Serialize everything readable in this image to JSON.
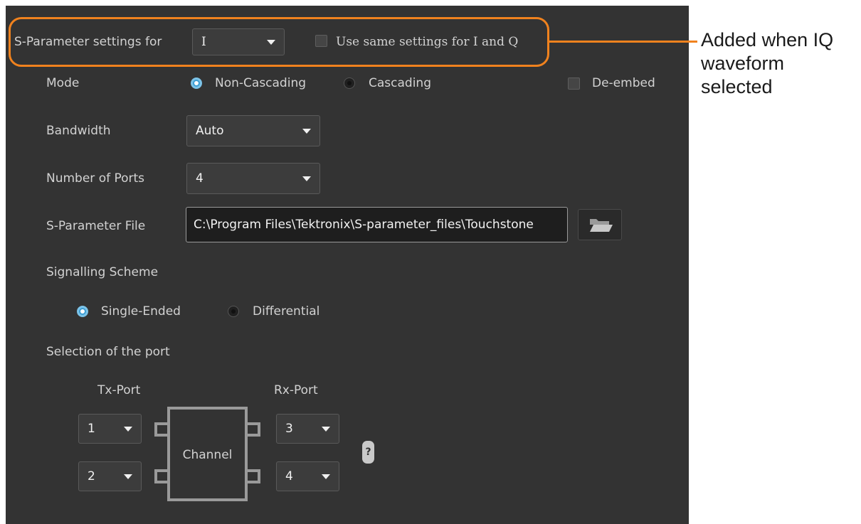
{
  "header": {
    "sparam_label": "S-Parameter settings for",
    "channel_value": "I",
    "same_settings_label": "Use same settings for I and Q"
  },
  "annotation": {
    "line1": "Added when IQ",
    "line2": "waveform selected",
    "color": "#f0821e"
  },
  "mode": {
    "label": "Mode",
    "options": [
      "Non-Cascading",
      "Cascading"
    ],
    "selected": "Non-Cascading",
    "deembed_label": "De-embed"
  },
  "bandwidth": {
    "label": "Bandwidth",
    "value": "Auto"
  },
  "ports": {
    "label": "Number of Ports",
    "value": "4"
  },
  "sparam_file": {
    "label": "S-Parameter File",
    "value": "C:\\Program Files\\Tektronix\\S-parameter_files\\Touchstone",
    "browse_icon": "folder-open-icon"
  },
  "signalling": {
    "label": "Signalling Scheme",
    "options": [
      "Single-Ended",
      "Differential"
    ],
    "selected": "Single-Ended"
  },
  "port_selection": {
    "label": "Selection of the port",
    "tx_label": "Tx-Port",
    "rx_label": "Rx-Port",
    "tx_ports": [
      "1",
      "2"
    ],
    "rx_ports": [
      "3",
      "4"
    ],
    "channel_label": "Channel",
    "help_label": "?"
  },
  "colors": {
    "panel_bg": "#333333",
    "accent_blue": "#3b9dd3",
    "highlight_orange": "#f0821e"
  }
}
